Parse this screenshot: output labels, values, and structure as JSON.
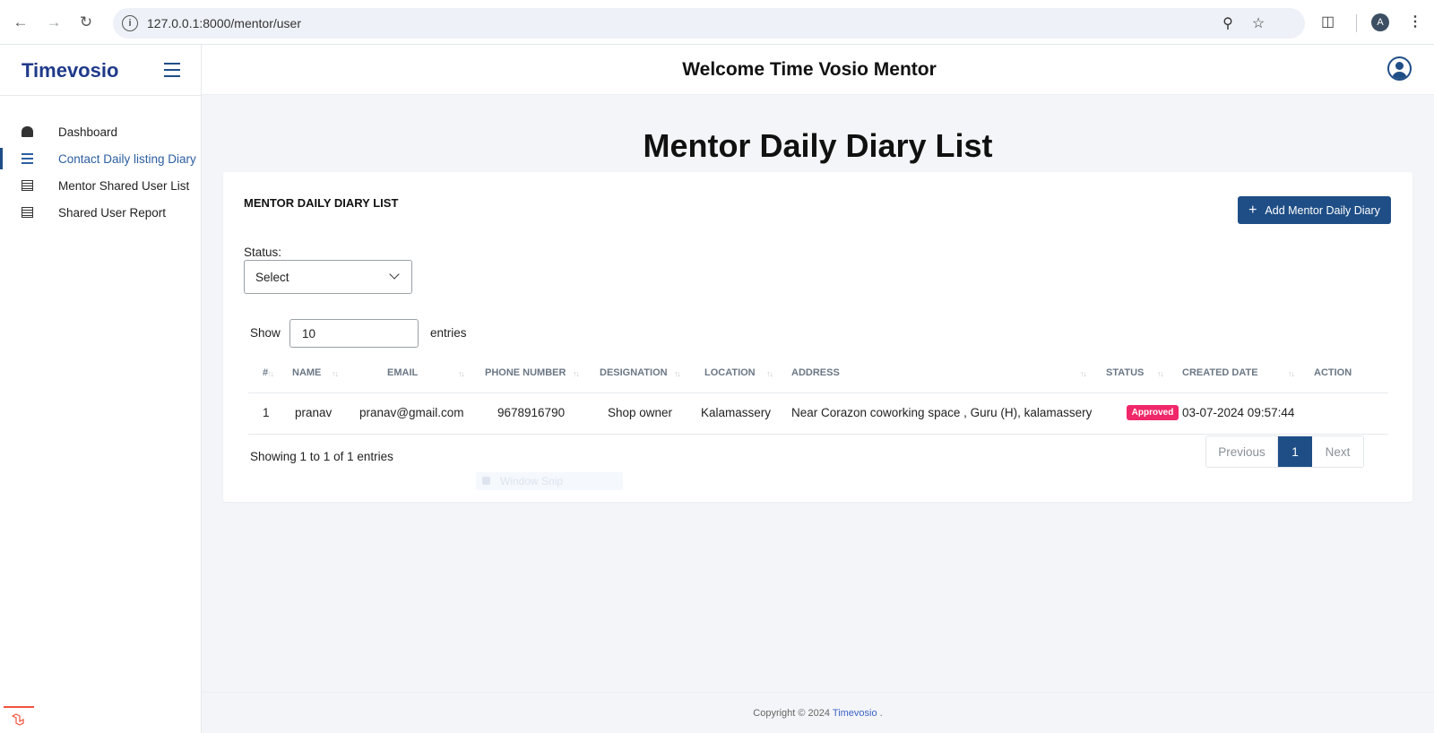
{
  "browser": {
    "url": "127.0.0.1:8000/mentor/user",
    "profile_initial": "A"
  },
  "sidebar": {
    "brand": "Timevosio",
    "items": [
      {
        "label": "Dashboard",
        "icon": "dashboard-icon"
      },
      {
        "label": "Contact Daily listing Diary",
        "icon": "list-icon",
        "active": true
      },
      {
        "label": "Mentor Shared User List",
        "icon": "table-icon"
      },
      {
        "label": "Shared User Report",
        "icon": "table-icon"
      }
    ]
  },
  "header": {
    "welcome": "Welcome Time Vosio Mentor"
  },
  "page": {
    "title": "Mentor Daily Diary List",
    "card_title": "MENTOR DAILY DIARY LIST",
    "add_button": "Add Mentor Daily Diary",
    "status_label": "Status:",
    "status_value": "Select",
    "show_label": "Show",
    "show_value": "10",
    "entries_label": "entries",
    "ghost_tooltip": "Window Snip"
  },
  "table": {
    "columns": [
      "#",
      "NAME",
      "EMAIL",
      "PHONE NUMBER",
      "DESIGNATION",
      "LOCATION",
      "ADDRESS",
      "STATUS",
      "CREATED DATE",
      "ACTION"
    ],
    "rows": [
      {
        "index": "1",
        "name": "pranav",
        "email": "pranav@gmail.com",
        "phone": "9678916790",
        "designation": "Shop owner",
        "location": "Kalamassery",
        "address": "Near Corazon coworking space , Guru (H), kalamassery",
        "status": "Approved",
        "created": "03-07-2024 09:57:44"
      }
    ],
    "info": "Showing 1 to 1 of 1 entries",
    "pagination": {
      "previous": "Previous",
      "current": "1",
      "next": "Next"
    }
  },
  "footer": {
    "prefix": "Copyright © 2024 ",
    "link": "Timevosio",
    "suffix": " ."
  },
  "colors": {
    "brand": "#1f3a8a",
    "primary": "#1f4e86",
    "badge": "#f0286a",
    "link": "#3b63c7"
  }
}
